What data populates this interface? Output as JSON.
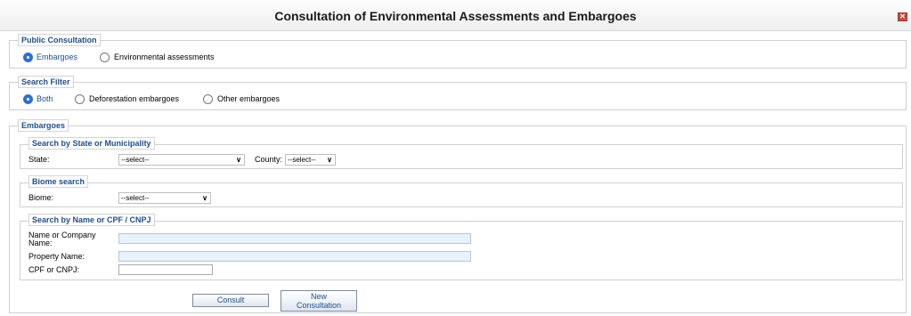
{
  "window": {
    "title": "Consultation of Environmental Assessments and Embargoes",
    "close_glyph": "✕"
  },
  "public_consultation": {
    "legend": "Public Consultation",
    "options": [
      {
        "label": "Embargoes",
        "selected": true
      },
      {
        "label": "Environmental assessments",
        "selected": false
      }
    ]
  },
  "search_filter": {
    "legend": "Search Filter",
    "options": [
      {
        "label": "Both",
        "selected": true
      },
      {
        "label": "Deforestation embargoes",
        "selected": false
      },
      {
        "label": "Other embargoes",
        "selected": false
      }
    ]
  },
  "embargoes": {
    "legend": "Embargoes",
    "state_municipality": {
      "legend": "Search by State or Municipality",
      "state_label": "State:",
      "state_value": "--select--",
      "county_label": "County:",
      "county_value": "--select--"
    },
    "biome": {
      "legend": "Biome search",
      "biome_label": "Biome:",
      "biome_value": "--select--"
    },
    "name_cpf": {
      "legend": "Search by Name or CPF / CNPJ",
      "name_label_line1": "Name or Company",
      "name_label_line2": "Name:",
      "property_label": "Property Name:",
      "cpf_label": "CPF or CNPJ:",
      "name_value": "",
      "property_value": "",
      "cpf_value": ""
    }
  },
  "buttons": {
    "consult": "Consult",
    "new_line1": "New",
    "new_line2": "Consultation"
  },
  "icons": {
    "chevron": "∨"
  },
  "colors": {
    "accent": "#1f4e8c",
    "radio_selected": "#2f6fd3",
    "input_fill": "#e8f2fb",
    "close": "#c9473d"
  }
}
